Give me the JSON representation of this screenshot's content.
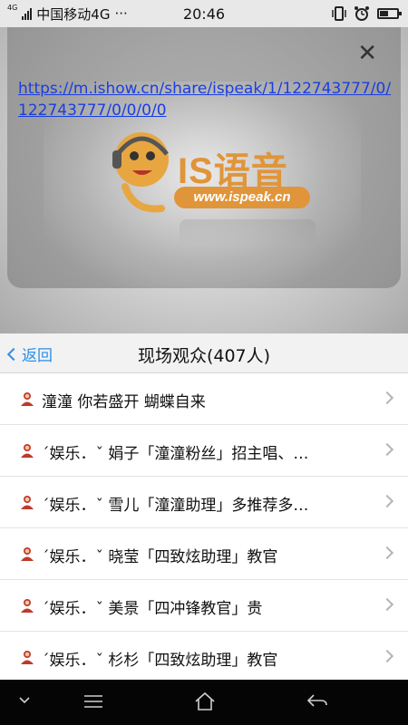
{
  "status_bar": {
    "network_small": "4G",
    "carrier": "中国移动4G",
    "dots": "···",
    "time": "20:46",
    "icons": [
      "signal-icon",
      "vibrate-icon",
      "alarm-icon",
      "battery-icon"
    ]
  },
  "share_popup": {
    "url": "https://m.ishow.cn/share/ispeak/1/122743777/0/122743777/0/0/0/0",
    "close_icon": "close-icon",
    "logo_text": "IS语音",
    "logo_url": "www.ispeak.cn"
  },
  "header": {
    "back_label": "返回",
    "title": "现场观众(407人)"
  },
  "audience": [
    {
      "text": "潼潼  你若盛开 蝴蝶自来"
    },
    {
      "text": "ˊ娱乐．ˇ 娟子「潼潼粉丝」招主唱、…"
    },
    {
      "text": " ˊ娱乐．ˇ 雪儿「潼潼助理」多推荐多…"
    },
    {
      "text": "ˊ娱乐．ˇ 晓莹「四致炫助理」教官"
    },
    {
      "text": "ˊ娱乐．ˇ 美景「四冲锋教官」贵"
    },
    {
      "text": "ˊ娱乐．ˇ 杉杉「四致炫助理」教官"
    }
  ],
  "bottom_nav": {
    "icons": [
      "collapse-icon",
      "menu-icon",
      "home-icon",
      "back-icon"
    ]
  },
  "colors": {
    "link": "#1a3ee0",
    "accent": "#2a8fe8",
    "logo": "#e0953a",
    "user_icon": "#c0392b"
  }
}
